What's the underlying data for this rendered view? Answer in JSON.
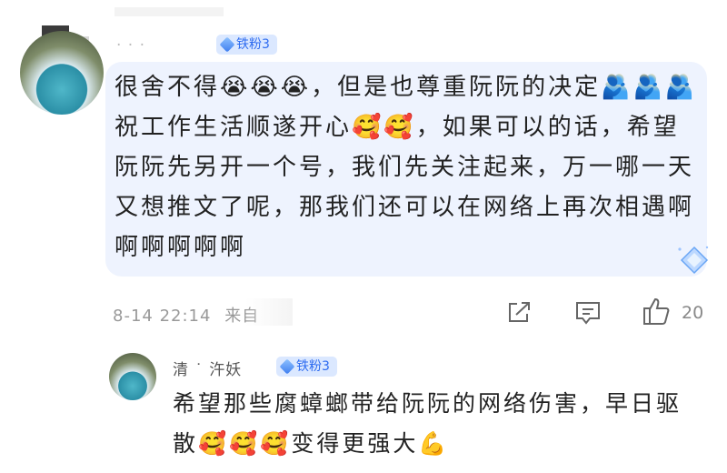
{
  "comment1": {
    "badge_label": "铁粉3",
    "text": "很舍不得😭😭😭，但是也尊重阮阮的决定🫂🫂🫂祝工作生活顺遂开心🥰🥰，如果可以的话，希望阮阮先另开一个号，我们先关注起来，万一哪一天又想推文了呢，那我们还可以在网络上再次相遇啊啊啊啊啊啊",
    "timestamp": "8-14 22:14",
    "source_prefix": "来自",
    "like_count": "20"
  },
  "reply1": {
    "name": "清 ˙ 汻妖",
    "badge_label": "铁粉3",
    "text": "希望那些腐蟑螂带给阮阮的网络伤害，早日驱散🥰🥰🥰变得更强大💪"
  },
  "icons": {
    "share": "share-icon",
    "comment": "comment-icon",
    "like": "thumbs-up-icon"
  },
  "colors": {
    "bubble_bg": "#eef3fe",
    "badge_bg": "#dbe8ff",
    "badge_text": "#2d6bf0"
  }
}
